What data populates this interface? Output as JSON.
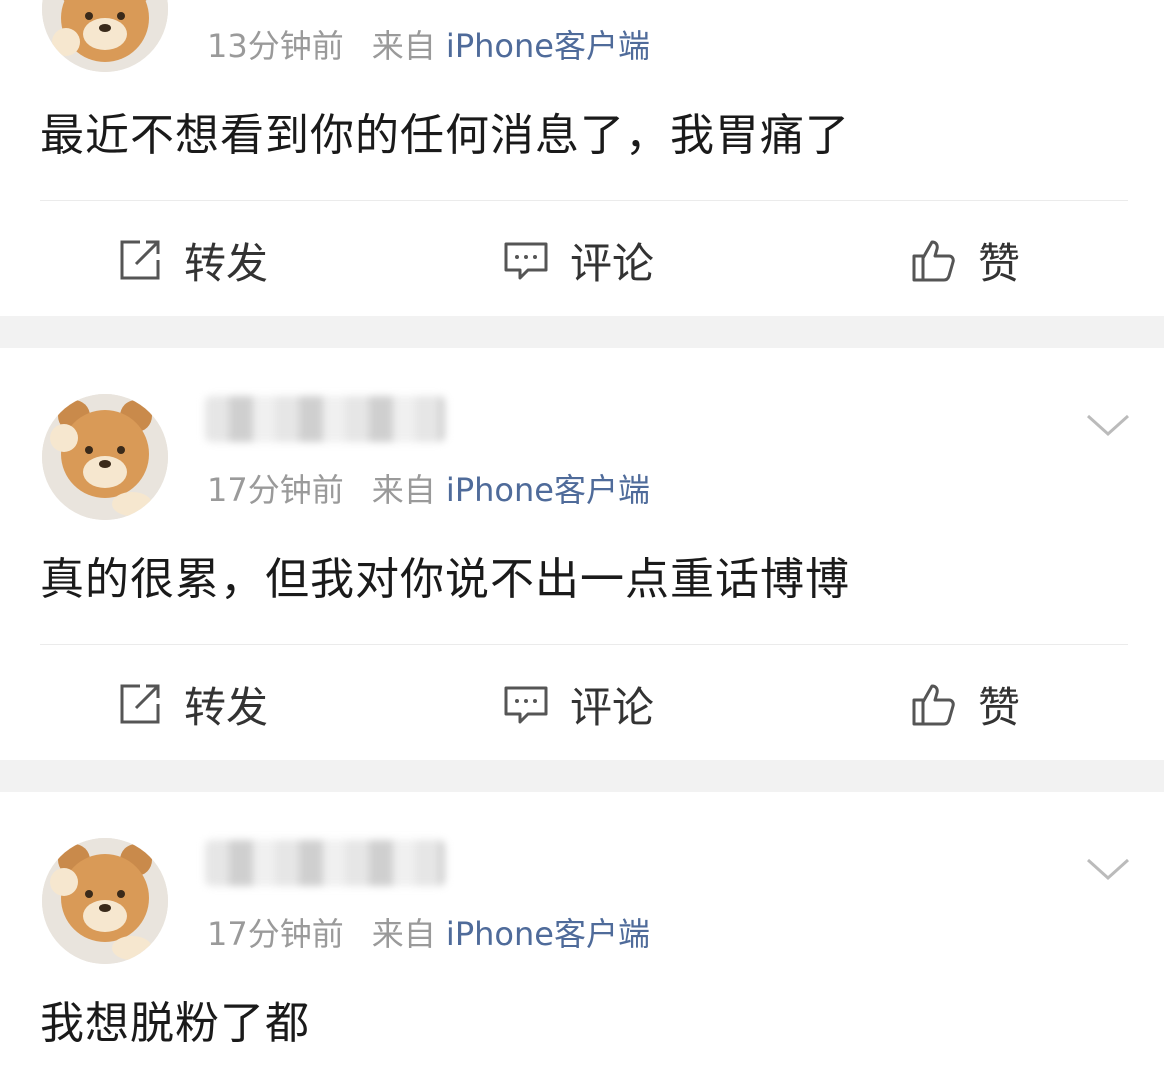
{
  "posts": [
    {
      "username": "",
      "time": "13分钟前",
      "source_prefix": "来自",
      "source": "iPhone客户端",
      "content": "最近不想看到你的任何消息了，我胃痛了"
    },
    {
      "username": "",
      "time": "17分钟前",
      "source_prefix": "来自",
      "source": "iPhone客户端",
      "content": "真的很累，但我对你说不出一点重话博博"
    },
    {
      "username": "",
      "time": "17分钟前",
      "source_prefix": "来自",
      "source": "iPhone客户端",
      "content": "我想脱粉了都"
    }
  ],
  "actions": {
    "repost": "转发",
    "comment": "评论",
    "like": "赞"
  },
  "icons": {
    "repost": "share-edit-icon",
    "comment": "comment-bubble-icon",
    "like": "thumbs-up-icon",
    "more": "chevron-down-icon"
  },
  "colors": {
    "source_link": "#4f6b9a",
    "meta_text": "#9a9a9a",
    "background": "#f2f2f2"
  }
}
